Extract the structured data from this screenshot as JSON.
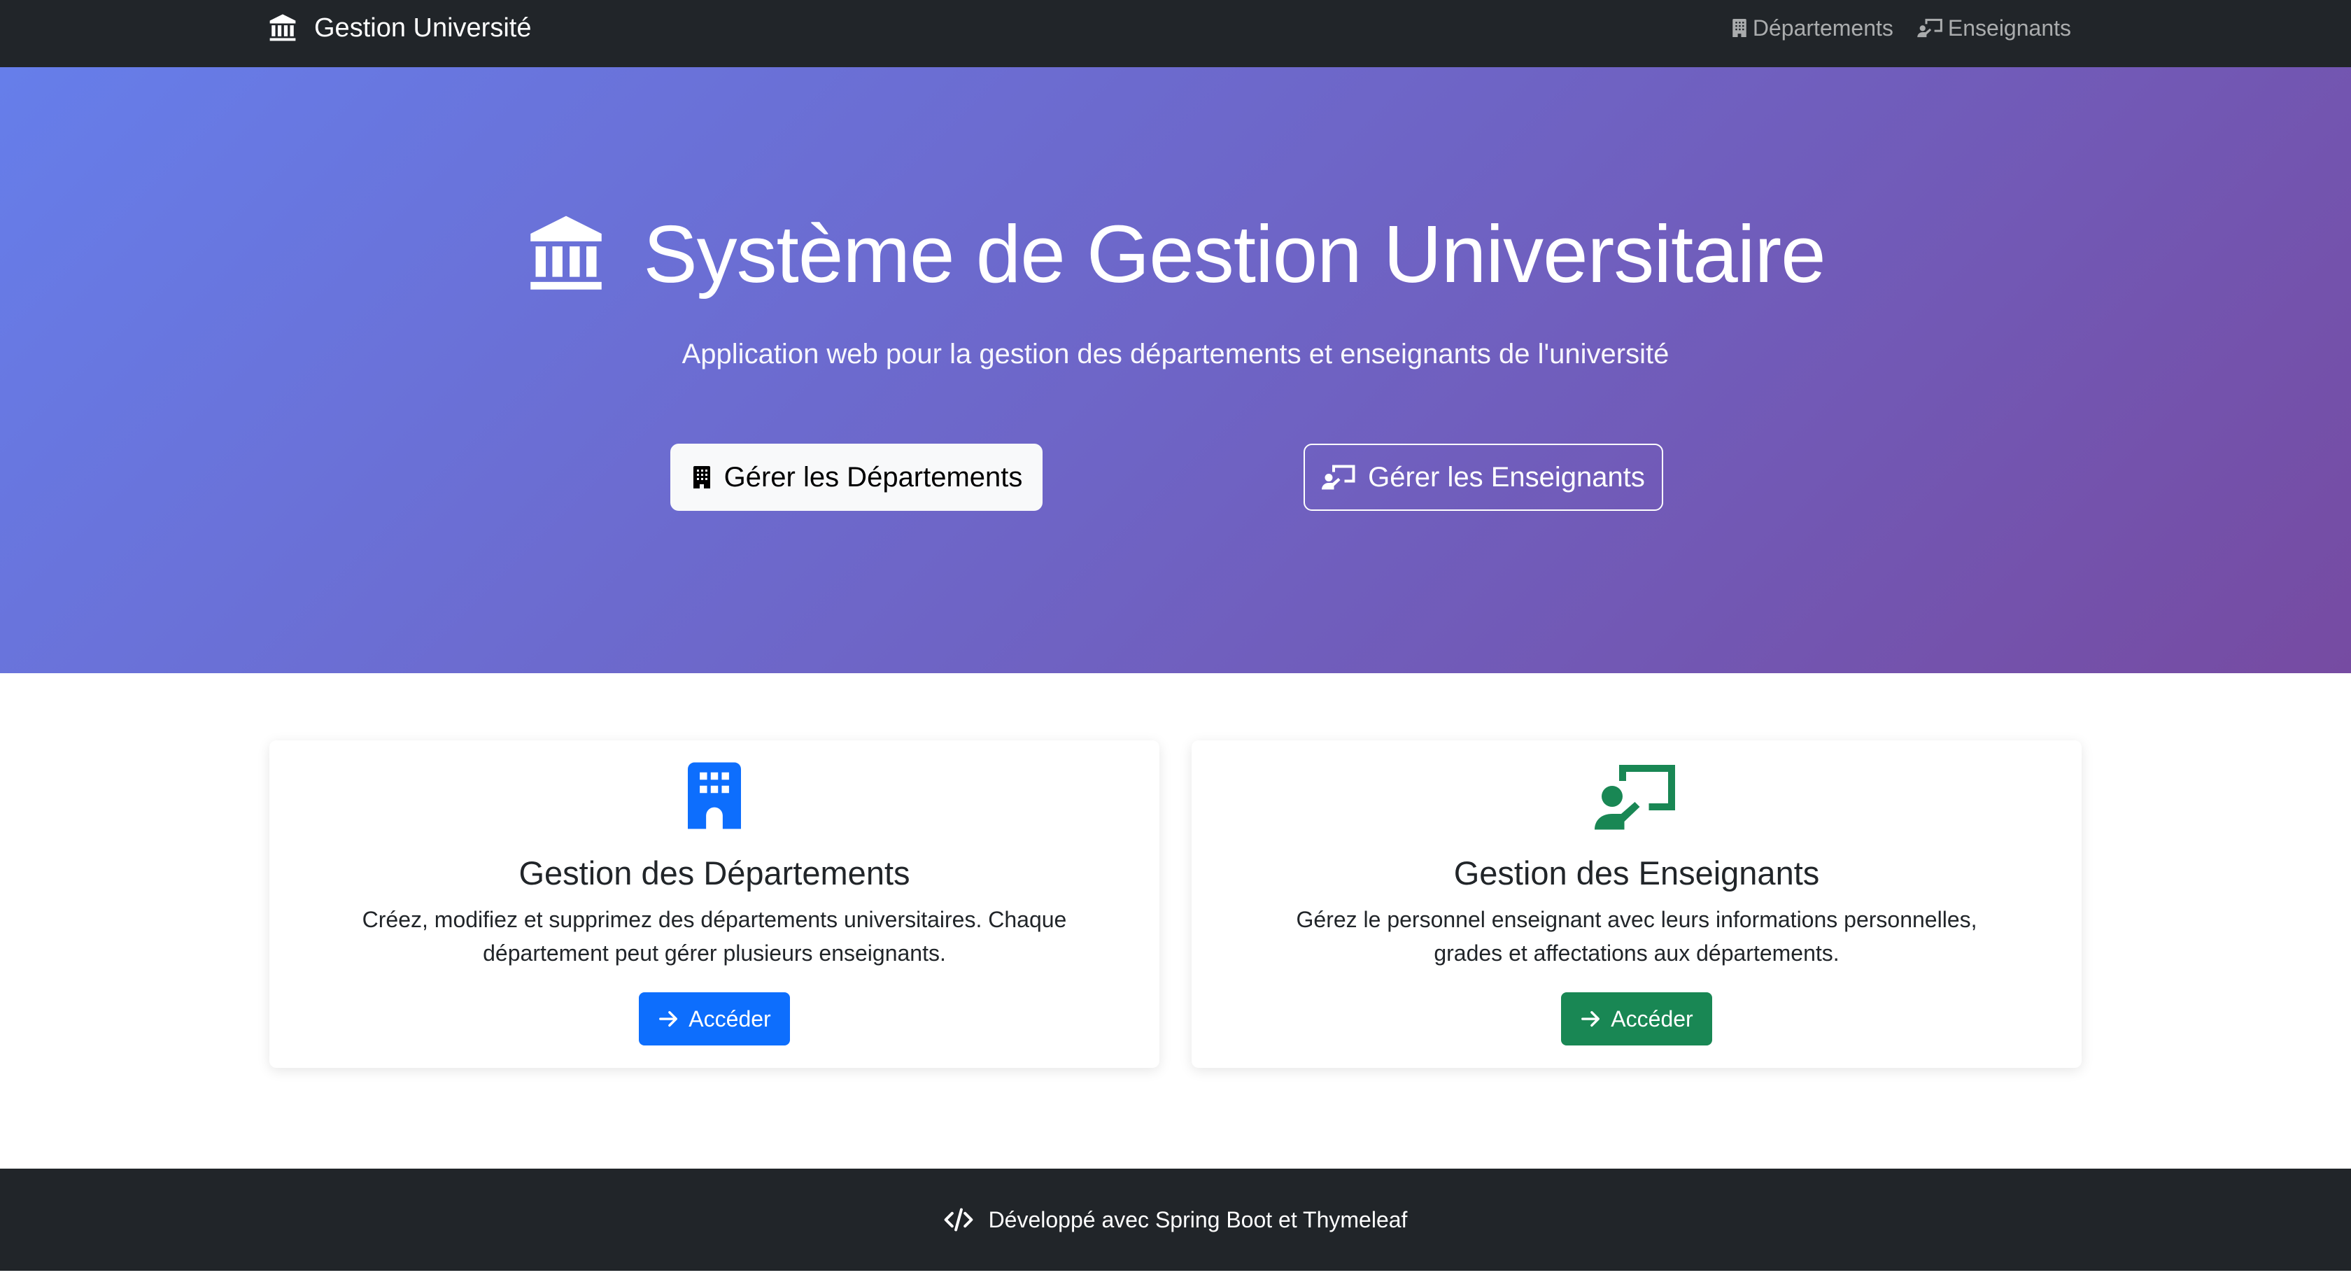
{
  "navbar": {
    "brand_icon": "bank-icon",
    "brand_label": "Gestion Université",
    "links": [
      {
        "icon": "building-icon",
        "label": "Départements"
      },
      {
        "icon": "teacher-board-icon",
        "label": "Enseignants"
      }
    ]
  },
  "hero": {
    "title_icon": "bank-icon",
    "title": "Système de Gestion Universitaire",
    "subtitle": "Application web pour la gestion des départements et enseignants de l'université",
    "buttons": [
      {
        "icon": "building-icon",
        "label": "Gérer les Départements"
      },
      {
        "icon": "teacher-board-icon",
        "label": "Gérer les Enseignants"
      }
    ],
    "gradient_start": "#667eea",
    "gradient_end": "#764ba2"
  },
  "cards": [
    {
      "icon": "building-icon",
      "icon_color": "#0d6efd",
      "title": "Gestion des Départements",
      "text": "Créez, modifiez et supprimez des départements universitaires. Chaque département peut gérer plusieurs enseignants.",
      "button_icon": "arrow-right-icon",
      "button_label": "Accéder",
      "button_color": "#0d6efd"
    },
    {
      "icon": "teacher-board-icon",
      "icon_color": "#198754",
      "title": "Gestion des Enseignants",
      "text": "Gérez le personnel enseignant avec leurs informations personnelles, grades et affectations aux départements.",
      "button_icon": "arrow-right-icon",
      "button_label": "Accéder",
      "button_color": "#198754"
    }
  ],
  "footer": {
    "icon": "code-slash-icon",
    "text": "Développé avec Spring Boot et Thymeleaf"
  }
}
